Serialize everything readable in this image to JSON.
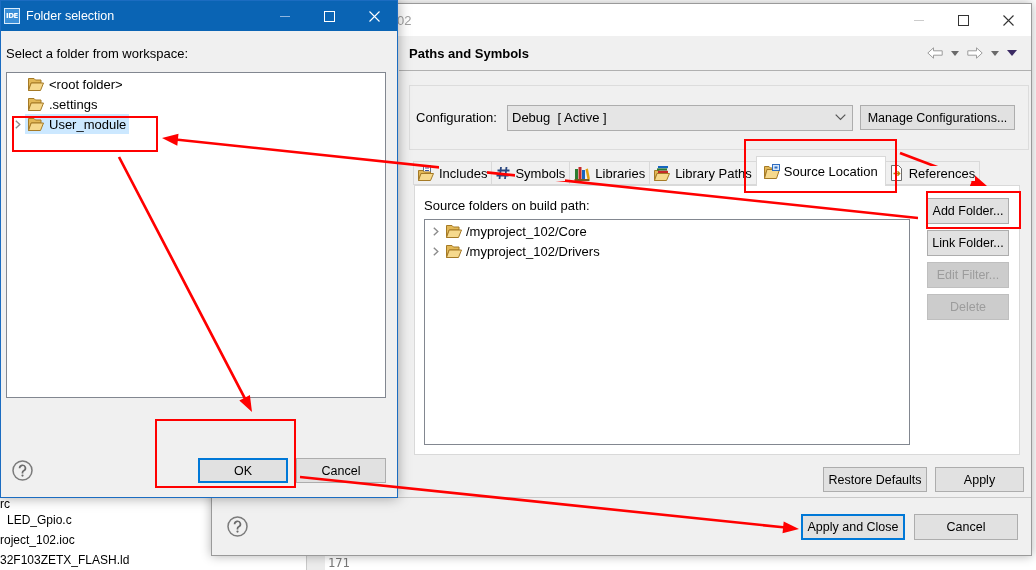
{
  "background_ide": {
    "explorer_tree": [
      {
        "label": "rc",
        "children": [
          {
            "label": "LED_Gpio.c"
          }
        ]
      },
      {
        "label": "roject_102.ioc"
      },
      {
        "label": "32F103ZETX_FLASH.ld"
      }
    ],
    "editor_line_numbers": [
      "171"
    ]
  },
  "properties_dialog": {
    "title": "02",
    "page_title": "Paths and Symbols",
    "configuration": {
      "label": "Configuration:",
      "value": "Debug  [ Active ]",
      "button": "Manage Configurations..."
    },
    "tabs": [
      {
        "kind": "includes",
        "label": "Includes",
        "selected": false,
        "marked": false
      },
      {
        "kind": "symbols",
        "label": "Symbols",
        "selected": false,
        "marked": false
      },
      {
        "kind": "libraries",
        "label": "Libraries",
        "selected": false,
        "marked": false
      },
      {
        "kind": "library_paths",
        "label": "Library Paths",
        "selected": false,
        "marked": false
      },
      {
        "kind": "source_location",
        "label": "Source Location",
        "selected": true,
        "marked": true
      },
      {
        "kind": "references",
        "label": "References",
        "selected": false,
        "marked": false
      }
    ],
    "source_folders": {
      "label": "Source folders on build path:",
      "items": [
        {
          "label": "/myproject_102/Core",
          "expanded": false
        },
        {
          "label": "/myproject_102/Drivers",
          "expanded": false
        }
      ]
    },
    "side_buttons": [
      {
        "label": "Add Folder...",
        "disabled": false,
        "marked": true
      },
      {
        "label": "Link Folder...",
        "disabled": false,
        "marked": false
      },
      {
        "label": "Edit Filter...",
        "disabled": true,
        "marked": false
      },
      {
        "label": "Delete",
        "disabled": true,
        "marked": false
      }
    ],
    "page_buttons": [
      "Restore Defaults",
      "Apply"
    ],
    "dialog_buttons": [
      {
        "label": "Apply and Close",
        "default": true
      },
      {
        "label": "Cancel",
        "default": false
      }
    ]
  },
  "folder_dialog": {
    "app_icon": "IDE",
    "title": "Folder selection",
    "prompt": "Select a folder from workspace:",
    "tree": [
      {
        "label": "<root folder>",
        "expandable": false,
        "selected": false,
        "marked": false
      },
      {
        "label": ".settings",
        "expandable": false,
        "selected": false,
        "marked": false
      },
      {
        "label": "User_module",
        "expandable": true,
        "selected": true,
        "marked": true
      }
    ],
    "buttons": [
      {
        "label": "OK",
        "default": true,
        "marked": true
      },
      {
        "label": "Cancel",
        "default": false,
        "marked": false
      }
    ]
  }
}
